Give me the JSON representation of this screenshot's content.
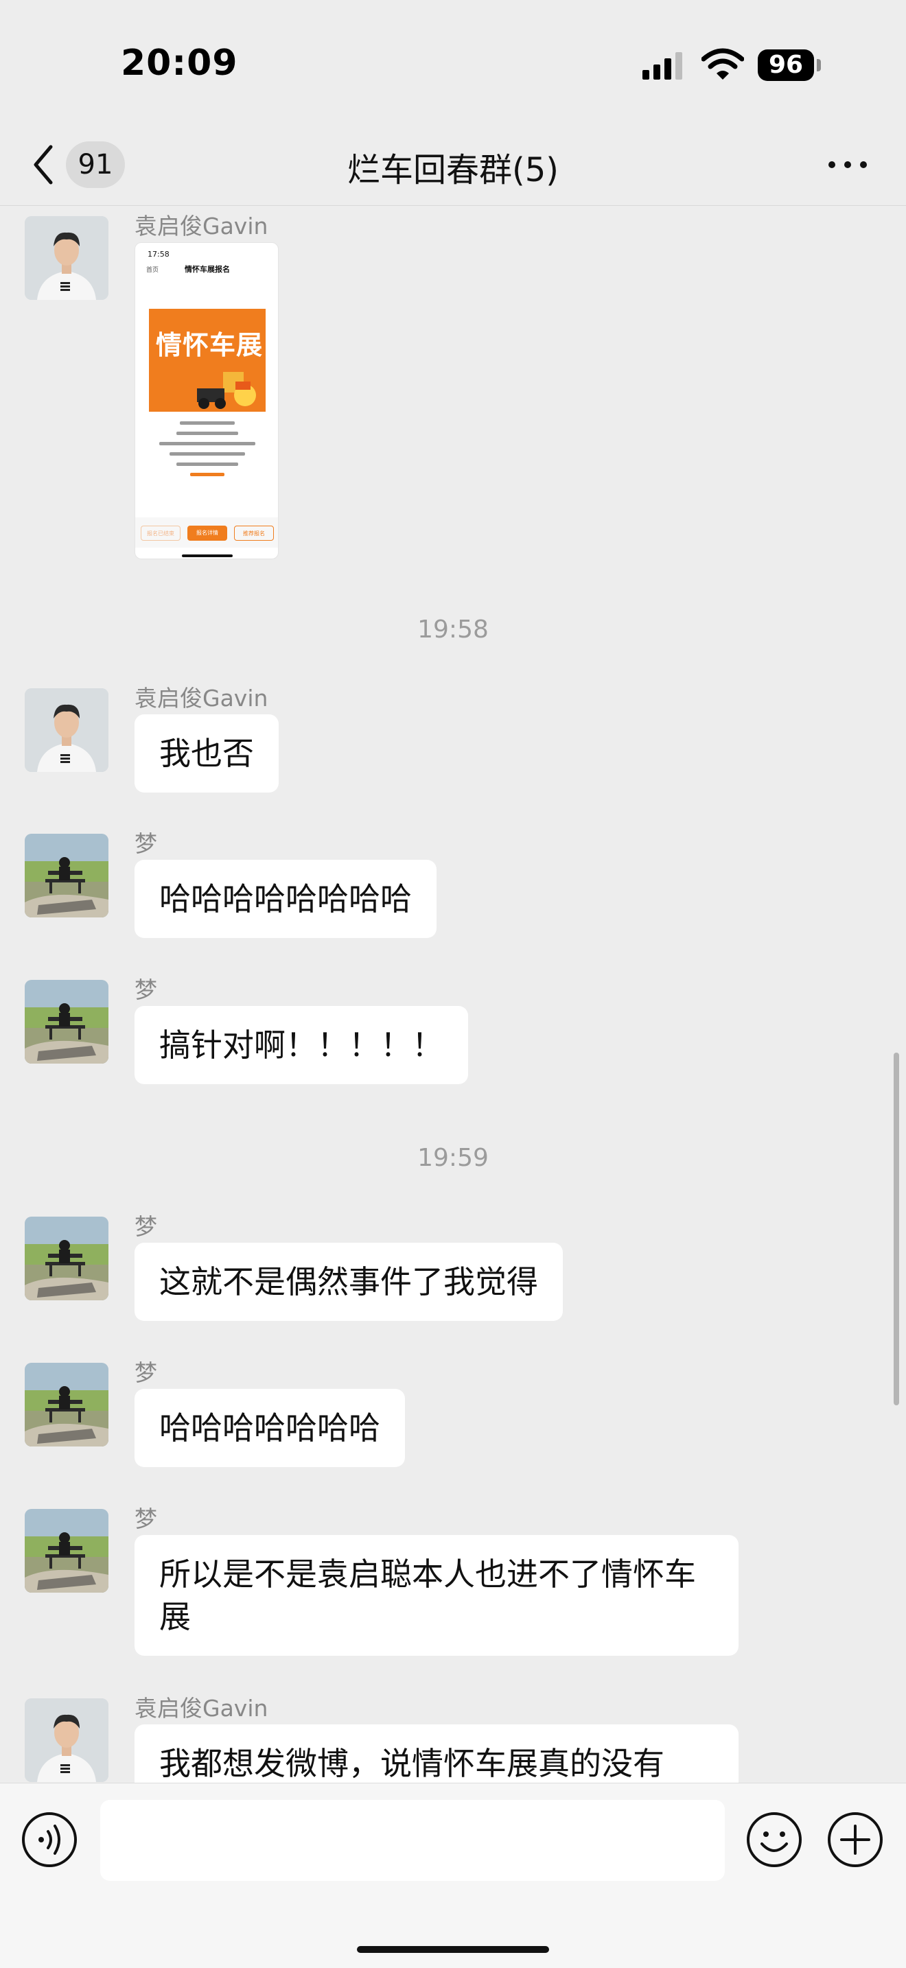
{
  "status_bar": {
    "time": "20:09",
    "battery": "96"
  },
  "nav": {
    "unread_count": "91",
    "title": "烂车回春群(5)"
  },
  "mini_card": {
    "time": "17:58",
    "home": "首页",
    "title": "情怀车展报名",
    "poster_title": "情怀车展",
    "buttons": [
      "报名已结束",
      "报名详情",
      "推荐报名"
    ]
  },
  "messages": [
    {
      "sender": "袁启俊Gavin",
      "type": "card"
    },
    {
      "type": "timestamp",
      "text": "19:58"
    },
    {
      "sender": "袁启俊Gavin",
      "text": "我也否"
    },
    {
      "sender": "梦",
      "text": "哈哈哈哈哈哈哈哈"
    },
    {
      "sender": "梦",
      "text": "搞针对啊！！！！！"
    },
    {
      "type": "timestamp",
      "text": "19:59"
    },
    {
      "sender": "梦",
      "text": "这就不是偶然事件了我觉得"
    },
    {
      "sender": "梦",
      "text": "哈哈哈哈哈哈哈"
    },
    {
      "sender": "梦",
      "text": "所以是不是袁启聪本人也进不了情怀车展"
    },
    {
      "sender": "袁启俊Gavin",
      "text": "我都想发微博，说情怀车展真的没有"
    }
  ],
  "input": {
    "value": ""
  },
  "icons": {
    "back": "chevron-left-icon",
    "more": "more-icon",
    "voice": "voice-icon",
    "emoji": "emoji-icon",
    "plus": "plus-icon",
    "signal": "signal-icon",
    "wifi": "wifi-icon"
  }
}
